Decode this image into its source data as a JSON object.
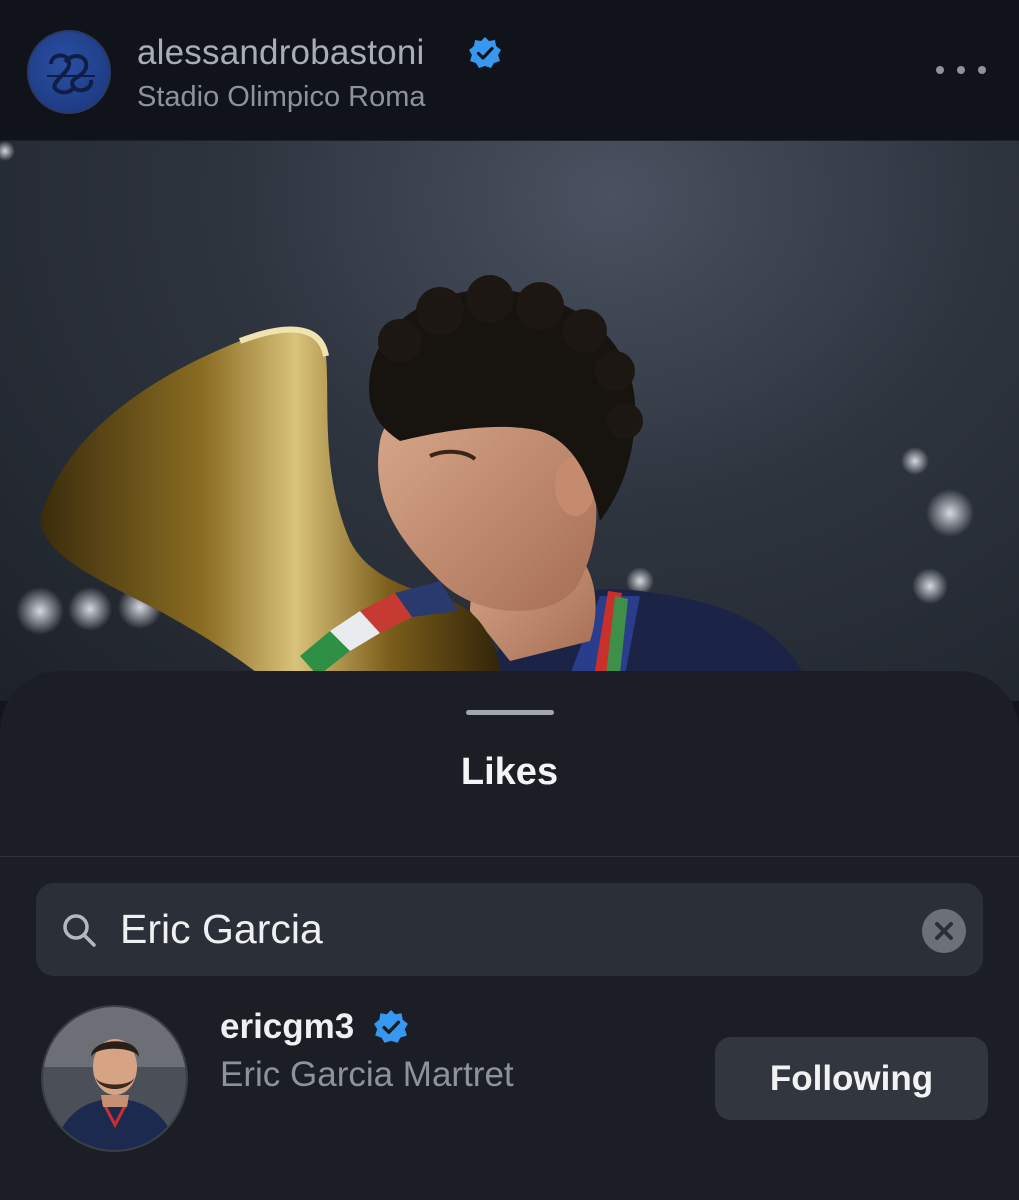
{
  "post": {
    "username": "alessandrobastoni",
    "location": "Stadio Olimpico Roma",
    "verified": true,
    "more_icon": "more-horizontal-icon"
  },
  "sheet": {
    "title": "Likes"
  },
  "search": {
    "value": "Eric Garcia",
    "icon": "search-icon",
    "clear_icon": "clear-icon"
  },
  "results": [
    {
      "handle": "ericgm3",
      "full_name": "Eric Garcia Martret",
      "verified": true,
      "button_label": "Following"
    }
  ],
  "colors": {
    "verified_badge": "#3897f0",
    "sheet_background": "#1b1f25",
    "search_background": "#2b3038",
    "button_background": "#31363f"
  }
}
